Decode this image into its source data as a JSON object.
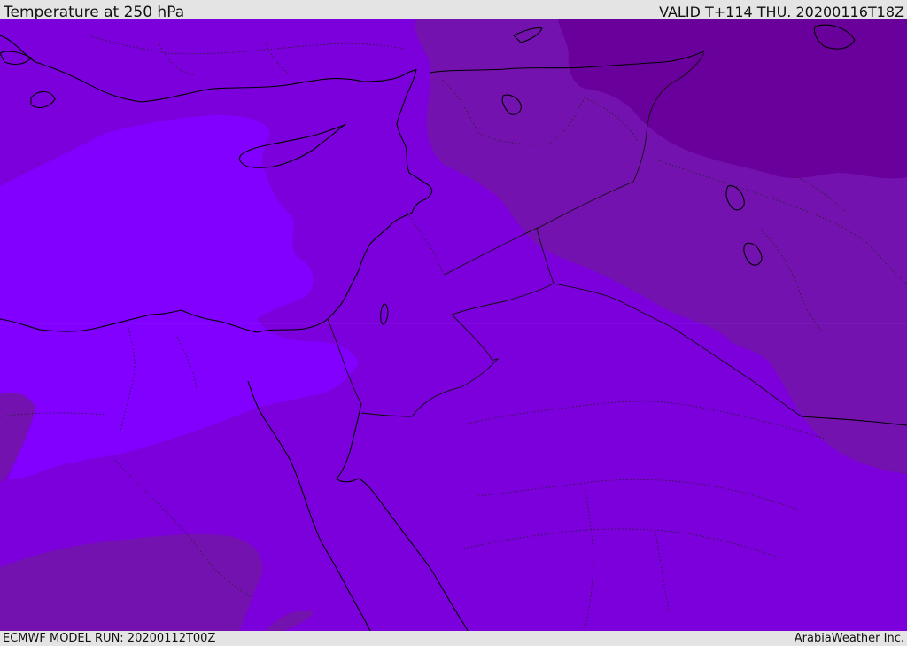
{
  "header": {
    "title": "Temperature at 250 hPa",
    "valid": "VALID T+114 THU. 20200116T18Z"
  },
  "footer": {
    "model_run": "ECMWF MODEL RUN: 20200112T00Z",
    "credit": "ArabiaWeather Inc."
  },
  "map": {
    "field": "temperature-250hPa",
    "region": "Eastern Mediterranean and Middle East",
    "colors": {
      "coldest": "#6a009c",
      "colder": "#7412b0",
      "base": "#7c00dc",
      "warm": "#8100ff",
      "coast": "#000000",
      "border": "#111111"
    }
  }
}
